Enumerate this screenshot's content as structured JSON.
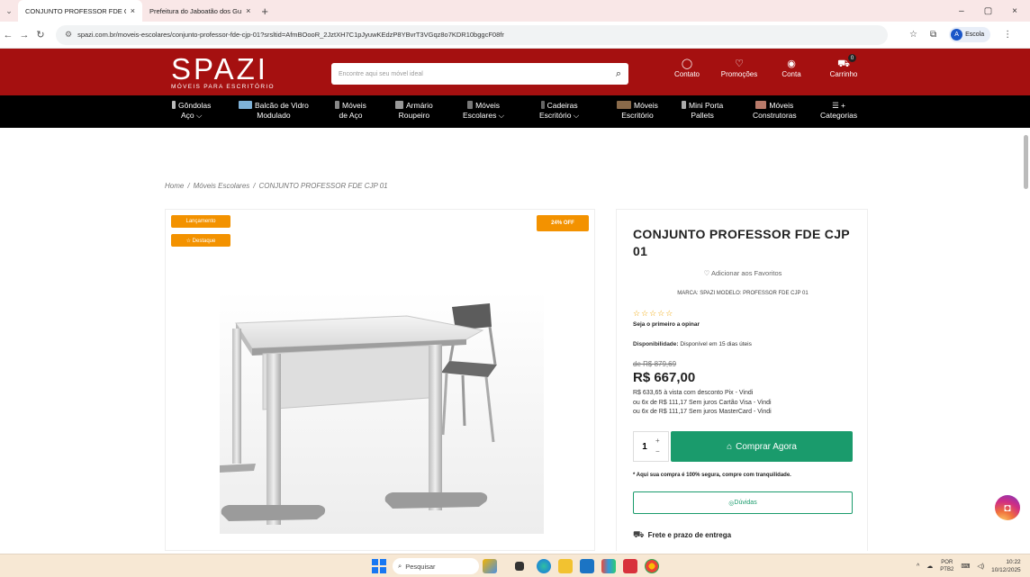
{
  "browser": {
    "tabs": [
      {
        "title": "CONJUNTO PROFESSOR FDE C",
        "favicon_color": "#a51010",
        "close": "×"
      },
      {
        "title": "Prefeitura do Jaboatão dos Gu",
        "favicon_color": "#1a56c8",
        "close": "×"
      }
    ],
    "new_tab": "+",
    "window_controls": [
      "–",
      "▢",
      "×"
    ],
    "url": "spazi.com.br/moveis-escolares/conjunto-professor-fde-cjp-01?srsltid=AfmBOooR_2JztXH7C1pJyuwKEdzP8YBvrT3VGqz8o7KDR10bggcF08fr",
    "profile_initial": "A",
    "profile_label": "Escola"
  },
  "header": {
    "logo_text": "SPAZI",
    "logo_subtitle": "MÓVEIS PARA ESCRITÓRIO",
    "search_placeholder": "Encontre aqui seu móvel ideal",
    "links": [
      {
        "icon": "chat-icon",
        "glyph": "◯",
        "label": "Contato"
      },
      {
        "icon": "heart-icon",
        "glyph": "♡",
        "label": "Promoções"
      },
      {
        "icon": "user-icon",
        "glyph": "◉",
        "label": "Conta"
      },
      {
        "icon": "cart-icon",
        "glyph": "🛒",
        "label": "Carrinho",
        "badge": "0"
      }
    ]
  },
  "categories": [
    {
      "line1": "Gôndolas",
      "line2": "Aço ⌵",
      "color": "#bbbbbb"
    },
    {
      "line1": "Balcão de Vidro",
      "line2": "Modulado",
      "color": "#7fb2d8"
    },
    {
      "line1": "Móveis",
      "line2": "de Aço",
      "color": "#888888"
    },
    {
      "line1": "Armário",
      "line2": "Roupeiro",
      "color": "#999999"
    },
    {
      "line1": "Móveis",
      "line2": "Escolares ⌵",
      "color": "#777777"
    },
    {
      "line1": "Cadeiras",
      "line2": "Escritório ⌵",
      "color": "#666666"
    },
    {
      "line1": "Móveis",
      "line2": "Escritório",
      "color": "#8a6a4a"
    },
    {
      "line1": "Mini Porta",
      "line2": "Pallets",
      "color": "#aaaaaa"
    },
    {
      "line1": "Móveis",
      "line2": "Construtoras",
      "color": "#b87a6a"
    },
    {
      "line1": "☰ +",
      "line2": "Categorias",
      "color": ""
    }
  ],
  "breadcrumb": [
    "Home",
    "Móveis Escolares",
    "CONJUNTO PROFESSOR FDE CJP 01"
  ],
  "badges": {
    "launch": "Lançamento",
    "highlight": "☆ Destaque",
    "discount": "24% OFF"
  },
  "product": {
    "title": "CONJUNTO PROFESSOR FDE CJP 01",
    "favorite": "♡ Adicionar aos Favoritos",
    "brand_model": "MARCA: SPAZI   MODELO: PROFESSOR FDE CJP 01",
    "stars": "☆☆☆☆☆",
    "first_review": "Seja o primeiro a opinar",
    "availability_label": "Disponibilidade:",
    "availability_value": "Disponível em 15 dias úteis",
    "old_price": "de R$ 879,69",
    "price": "R$ 667,00",
    "payment_lines": [
      "R$ 633,65 à vista com desconto Pix - Vindi",
      "ou 6x de R$ 111,17 Sem juros Cartão Visa - Vindi",
      "ou 6x de R$ 111,17 Sem juros MasterCard - Vindi"
    ],
    "qty": "1",
    "buy_label": "Comprar Agora",
    "secure_note": "* Aqui sua compra é 100% segura, compre com tranquilidade.",
    "doubts": "Dúvidas",
    "shipping": "Frete e prazo de entrega"
  },
  "taskbar": {
    "search_placeholder": "Pesquisar",
    "lang_line1": "POR",
    "lang_line2": "PTB2",
    "time": "10:22",
    "date": "10/12/2025"
  }
}
